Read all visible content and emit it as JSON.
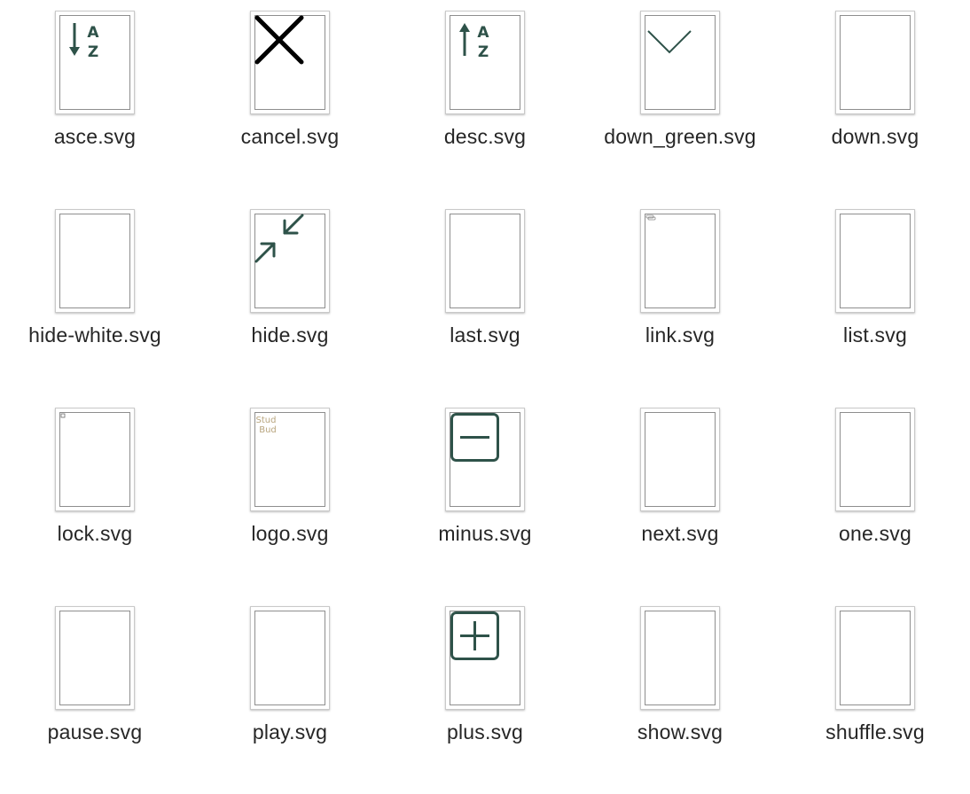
{
  "accent_color": "#2e5249",
  "files": [
    {
      "name": "asce.svg",
      "icon": "sort-ascending-icon"
    },
    {
      "name": "cancel.svg",
      "icon": "cancel-x-icon"
    },
    {
      "name": "desc.svg",
      "icon": "sort-descending-icon"
    },
    {
      "name": "down_green.svg",
      "icon": "chevron-down-icon"
    },
    {
      "name": "down.svg",
      "icon": "blank-icon"
    },
    {
      "name": "hide-white.svg",
      "icon": "blank-icon"
    },
    {
      "name": "hide.svg",
      "icon": "collapse-arrows-icon"
    },
    {
      "name": "last.svg",
      "icon": "blank-icon"
    },
    {
      "name": "link.svg",
      "icon": "link-tiny-icon"
    },
    {
      "name": "list.svg",
      "icon": "blank-icon"
    },
    {
      "name": "lock.svg",
      "icon": "lock-tiny-icon"
    },
    {
      "name": "logo.svg",
      "icon": "logo-icon",
      "logo_text": [
        "Stud",
        "Bud"
      ]
    },
    {
      "name": "minus.svg",
      "icon": "minus-square-icon"
    },
    {
      "name": "next.svg",
      "icon": "blank-icon"
    },
    {
      "name": "one.svg",
      "icon": "blank-icon"
    },
    {
      "name": "pause.svg",
      "icon": "blank-icon"
    },
    {
      "name": "play.svg",
      "icon": "blank-icon"
    },
    {
      "name": "plus.svg",
      "icon": "plus-square-icon"
    },
    {
      "name": "show.svg",
      "icon": "blank-icon"
    },
    {
      "name": "shuffle.svg",
      "icon": "blank-icon"
    }
  ]
}
